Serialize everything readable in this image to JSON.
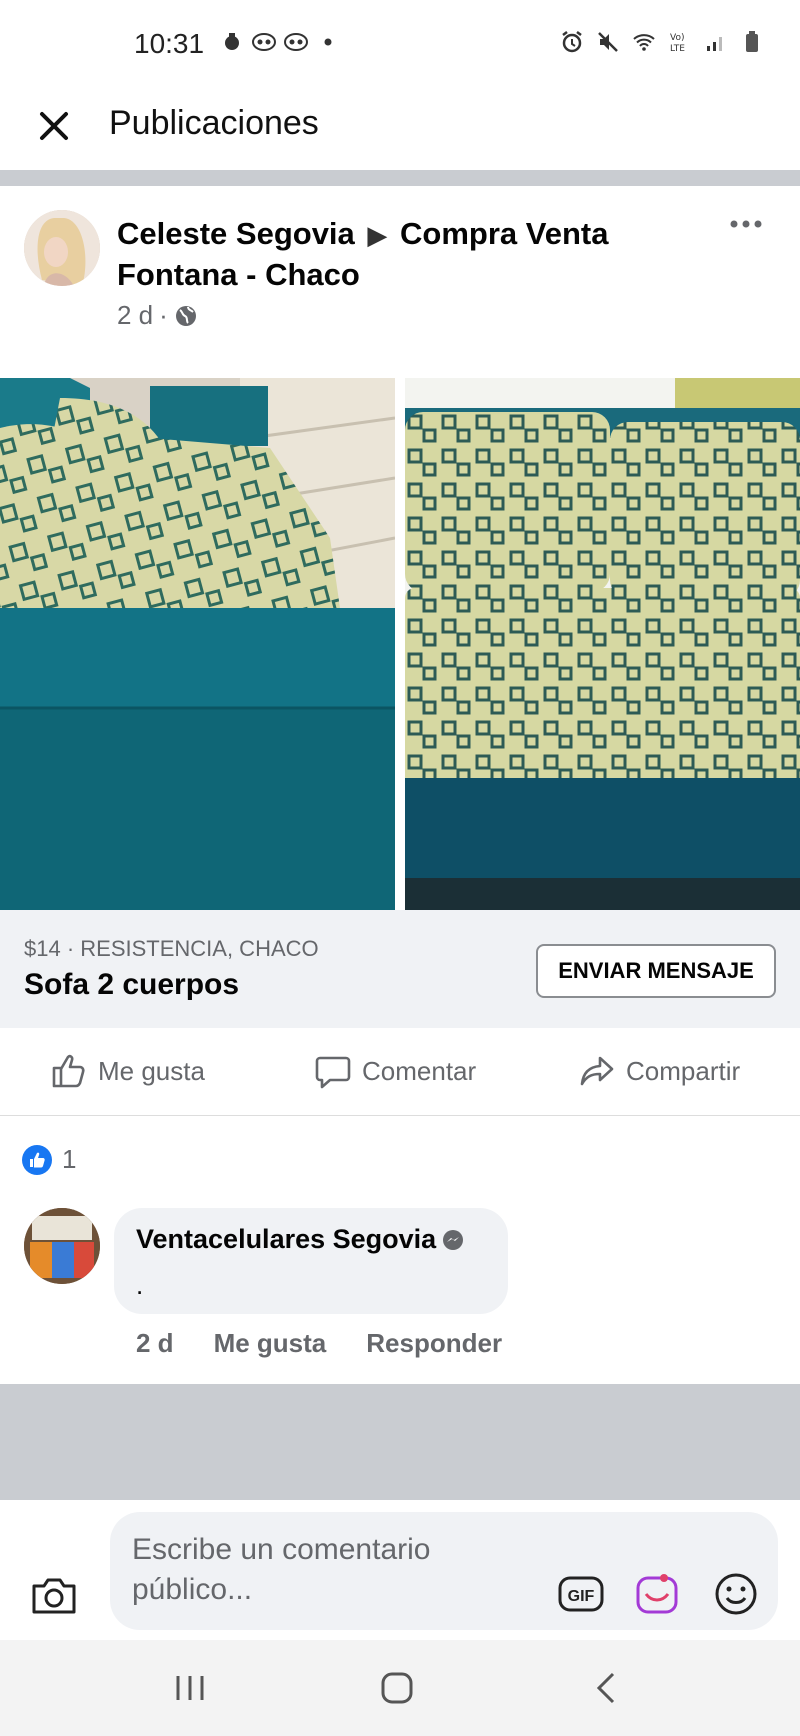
{
  "status_bar": {
    "time": "10:31",
    "left_icons": [
      "notification-icon",
      "voicemail-icon",
      "voicemail-icon",
      "dot-icon"
    ],
    "right_icons": [
      "alarm-icon",
      "mute-icon",
      "wifi-icon",
      "volte-icon",
      "signal-icon",
      "battery-icon"
    ],
    "volte_label": "Vo) LTE"
  },
  "header": {
    "title": "Publicaciones",
    "close_icon": "close-icon"
  },
  "post": {
    "author": "Celeste Segovia",
    "separator": "▶",
    "group": "Compra Venta Fontana - Chaco",
    "time": "2 d",
    "dot": "·",
    "audience_icon": "globe-icon",
    "more_icon": "more-icon",
    "photos": [
      "sofa-photo-side",
      "sofa-photo-front"
    ]
  },
  "marketplace": {
    "meta": "$14 · RESISTENCIA, CHACO",
    "title": "Sofa 2 cuerpos",
    "send_button": "ENVIAR MENSAJE"
  },
  "actions": {
    "like": "Me gusta",
    "comment": "Comentar",
    "share": "Compartir"
  },
  "reactions": {
    "count": "1"
  },
  "comment": {
    "author": "Ventacelulares Segovia",
    "text": ".",
    "time": "2 d",
    "like": "Me gusta",
    "reply": "Responder"
  },
  "composer": {
    "placeholder_line1": "Escribe un comentario",
    "placeholder_line2": "público...",
    "gif_label": "GIF"
  },
  "colors": {
    "brand_blue": "#1877f2",
    "secondary_text": "#65676b",
    "band_gray": "#c9ccd1"
  }
}
